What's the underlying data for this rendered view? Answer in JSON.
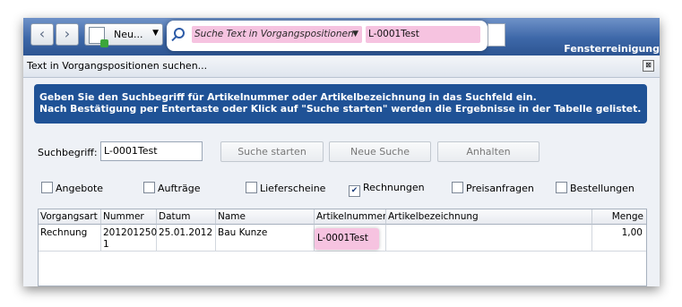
{
  "toolbar": {
    "back_icon": "chevron-left-icon",
    "forward_icon": "chevron-right-icon",
    "new_label": "Neu...",
    "search_field_label": "Suche Text in Vorgangspositionen",
    "search_value": "L-0001Test",
    "app_title": "Fensterreinigung"
  },
  "window": {
    "title": "Text in Vorgangspositionen suchen...",
    "close_glyph": "⊠"
  },
  "info": {
    "line1": "Geben Sie den Suchbegriff für Artikelnummer oder Artikelbezeichnung in das Suchfeld ein.",
    "line2": "Nach Bestätigung per Entertaste oder Klick auf \"Suche starten\" werden die Ergebnisse in der Tabelle gelistet."
  },
  "search": {
    "label": "Suchbegriff:",
    "value": "L-0001Test",
    "start_label": "Suche starten",
    "new_label": "Neue Suche",
    "stop_label": "Anhalten"
  },
  "filters": [
    {
      "label": "Angebote",
      "checked": false
    },
    {
      "label": "Aufträge",
      "checked": false
    },
    {
      "label": "Lieferscheine",
      "checked": false
    },
    {
      "label": "Rechnungen",
      "checked": true
    },
    {
      "label": "Preisanfragen",
      "checked": false
    },
    {
      "label": "Bestellungen",
      "checked": false
    }
  ],
  "grid": {
    "columns": [
      "Vorgangsart",
      "Nummer",
      "Datum",
      "Name",
      "Artikelnummer",
      "Artikelbezeichnung",
      "Menge"
    ],
    "rows": [
      {
        "vorgangsart": "Rechnung",
        "nummer_1": "201201250",
        "nummer_2": "1",
        "datum": "25.01.2012",
        "name": "Bau Kunze",
        "artikelnummer": "L-0001Test",
        "artikelbezeichnung": "",
        "menge": "1,00"
      }
    ]
  },
  "colors": {
    "highlight": "#f6c3e0",
    "info_bg": "#1f5296",
    "toolbar_bg": "#3d67a8"
  }
}
